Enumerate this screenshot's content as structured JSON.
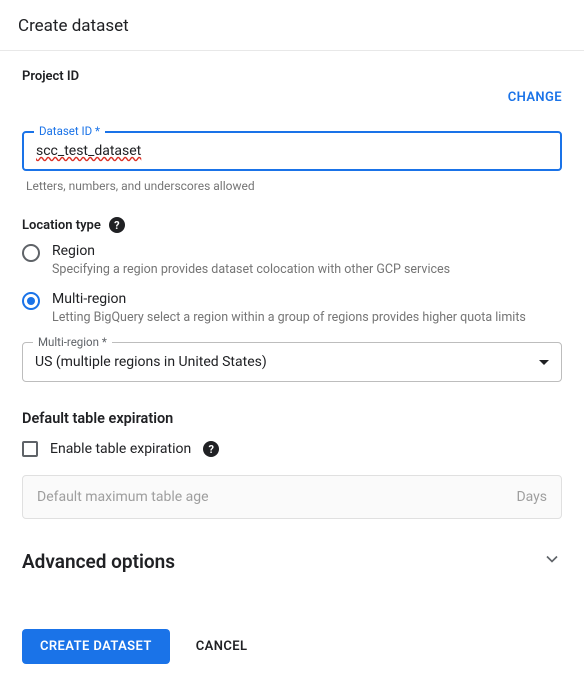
{
  "header": {
    "title": "Create dataset"
  },
  "project": {
    "label": "Project ID",
    "change_label": "CHANGE"
  },
  "dataset_id": {
    "label": "Dataset ID *",
    "value": "scc_test_dataset",
    "helper": "Letters, numbers, and underscores allowed"
  },
  "location": {
    "label": "Location type",
    "options": {
      "region": {
        "title": "Region",
        "desc": "Specifying a region provides dataset colocation with other GCP services",
        "selected": false
      },
      "multi_region": {
        "title": "Multi-region",
        "desc": "Letting BigQuery select a region within a group of regions provides higher quota limits",
        "selected": true
      }
    },
    "select": {
      "label": "Multi-region *",
      "value": "US (multiple regions in United States)"
    }
  },
  "expiration": {
    "label": "Default table expiration",
    "checkbox_label": "Enable table expiration",
    "input_placeholder": "Default maximum table age",
    "unit": "Days"
  },
  "advanced": {
    "title": "Advanced options"
  },
  "footer": {
    "primary": "CREATE DATASET",
    "cancel": "CANCEL"
  }
}
